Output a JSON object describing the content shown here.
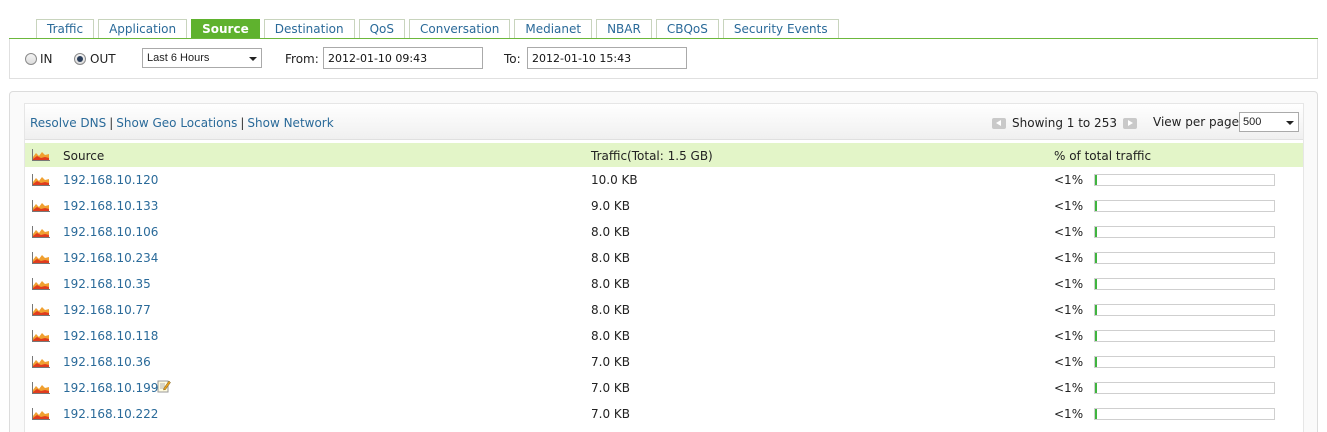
{
  "tabs": [
    {
      "label": "Traffic",
      "active": false
    },
    {
      "label": "Application",
      "active": false
    },
    {
      "label": "Source",
      "active": true
    },
    {
      "label": "Destination",
      "active": false
    },
    {
      "label": "QoS",
      "active": false
    },
    {
      "label": "Conversation",
      "active": false
    },
    {
      "label": "Medianet",
      "active": false
    },
    {
      "label": "NBAR",
      "active": false
    },
    {
      "label": "CBQoS",
      "active": false
    },
    {
      "label": "Security Events",
      "active": false
    }
  ],
  "filters": {
    "in_label": "IN",
    "out_label": "OUT",
    "direction": "OUT",
    "period": "Last 6 Hours",
    "from_label": "From:",
    "from_value": "2012-01-10 09:43",
    "to_label": "To:",
    "to_value": "2012-01-10 15:43"
  },
  "toolbar": {
    "resolve_dns": "Resolve DNS",
    "geo_locations": "Show Geo Locations",
    "show_network": "Show Network",
    "separator": "|",
    "showing": "Showing 1 to 253",
    "view_per_page_label": "View per page",
    "view_per_page": "500"
  },
  "table": {
    "headers": {
      "source": "Source",
      "traffic": "Traffic(Total: 1.5 GB)",
      "pct": "% of total traffic"
    },
    "rows": [
      {
        "source": "192.168.10.120",
        "traffic": "10.0 KB",
        "pct": "<1%",
        "fill": 0.005,
        "note": false
      },
      {
        "source": "192.168.10.133",
        "traffic": "9.0 KB",
        "pct": "<1%",
        "fill": 0.005,
        "note": false
      },
      {
        "source": "192.168.10.106",
        "traffic": "8.0 KB",
        "pct": "<1%",
        "fill": 0.005,
        "note": false
      },
      {
        "source": "192.168.10.234",
        "traffic": "8.0 KB",
        "pct": "<1%",
        "fill": 0.005,
        "note": false
      },
      {
        "source": "192.168.10.35",
        "traffic": "8.0 KB",
        "pct": "<1%",
        "fill": 0.005,
        "note": false
      },
      {
        "source": "192.168.10.77",
        "traffic": "8.0 KB",
        "pct": "<1%",
        "fill": 0.005,
        "note": false
      },
      {
        "source": "192.168.10.118",
        "traffic": "8.0 KB",
        "pct": "<1%",
        "fill": 0.005,
        "note": false
      },
      {
        "source": "192.168.10.36",
        "traffic": "7.0 KB",
        "pct": "<1%",
        "fill": 0.005,
        "note": false
      },
      {
        "source": "192.168.10.199",
        "traffic": "7.0 KB",
        "pct": "<1%",
        "fill": 0.005,
        "note": true
      },
      {
        "source": "192.168.10.222",
        "traffic": "7.0 KB",
        "pct": "<1%",
        "fill": 0.005,
        "note": false
      }
    ]
  },
  "colors": {
    "accent_green": "#5fb22e",
    "header_bg": "#e3f5c8",
    "link_blue": "#2a6a99",
    "bar_fill": "#3fb43f"
  },
  "icons": {
    "row_graph": "area-graph-icon",
    "note": "note-edit-icon"
  }
}
